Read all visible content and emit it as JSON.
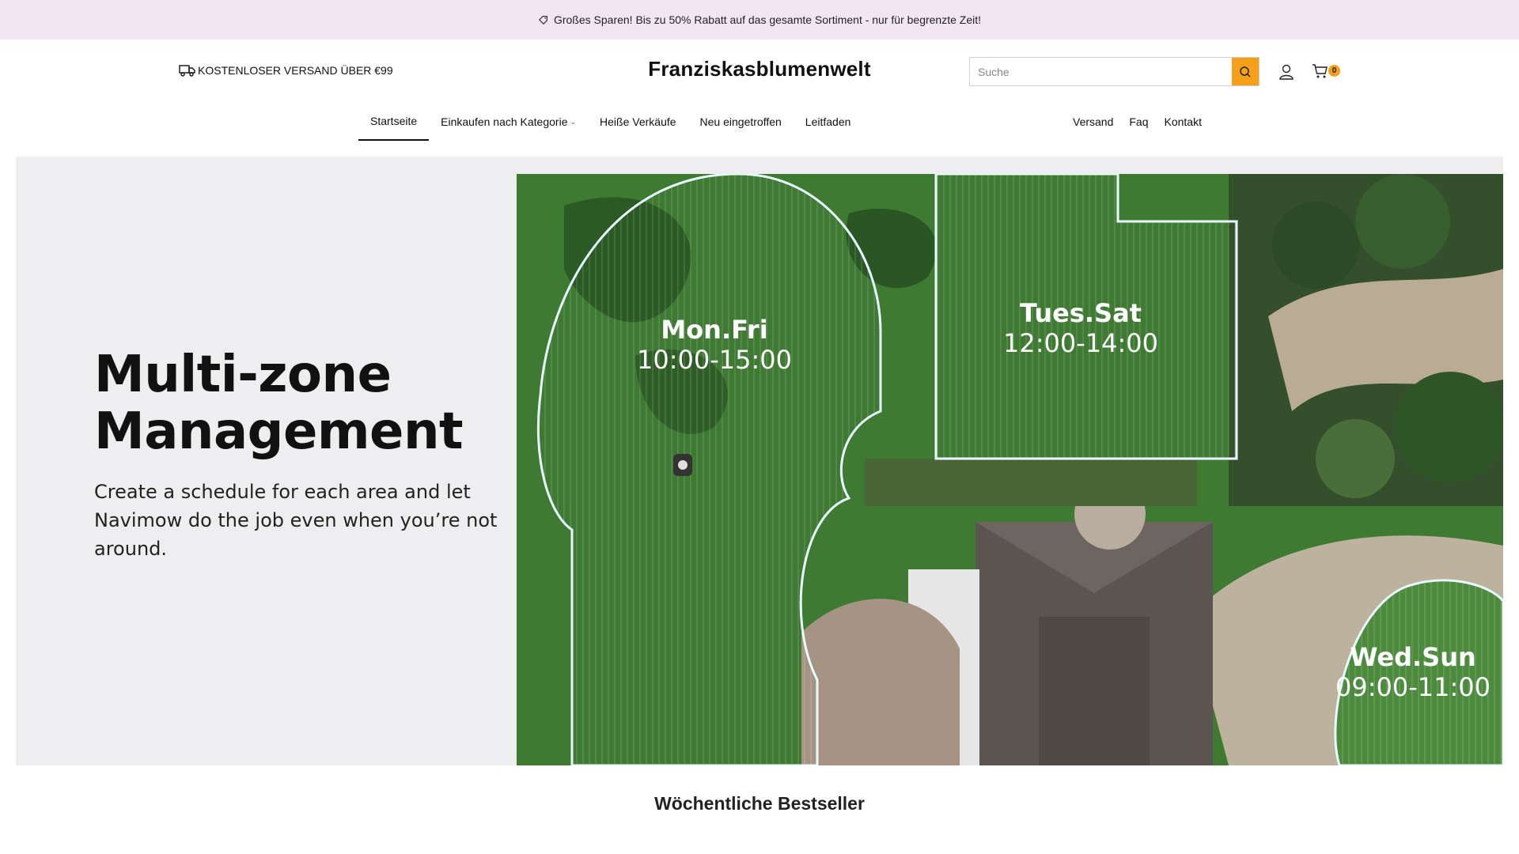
{
  "announcement": {
    "text": "Großes Sparen! Bis zu 50% Rabatt auf das gesamte Sortiment - nur für begrenzte Zeit!",
    "icon": "tag-icon"
  },
  "header": {
    "shipping_text": "KOSTENLOSER VERSAND ÜBER €99",
    "shipping_icon": "truck-icon",
    "logo": "Franziskasblumenwelt",
    "search": {
      "placeholder": "Suche",
      "value": ""
    },
    "cart_count": "0",
    "accent_color": "#f6a01a"
  },
  "nav": {
    "left": [
      {
        "label": "Startseite",
        "active": true
      },
      {
        "label": "Einkaufen nach Kategorie",
        "has_dropdown": true
      },
      {
        "label": "Heiße Verkäufe"
      },
      {
        "label": "Neu eingetroffen"
      },
      {
        "label": "Leitfaden"
      }
    ],
    "right": [
      {
        "label": "Versand"
      },
      {
        "label": "Faq"
      },
      {
        "label": "Kontakt"
      }
    ]
  },
  "hero": {
    "title_line1": "Multi-zone",
    "title_line2": "Management",
    "subtitle": "Create a schedule for each area and let Navimow do the job even when you’re not around.",
    "zones": [
      {
        "days": "Mon.Fri",
        "time": "10:00-15:00"
      },
      {
        "days": "Tues.Sat",
        "time": "12:00-14:00"
      },
      {
        "days": "Wed.Sun",
        "time": "09:00-11:00"
      }
    ]
  },
  "bestsellers": {
    "title": "Wöchentliche Bestseller"
  }
}
